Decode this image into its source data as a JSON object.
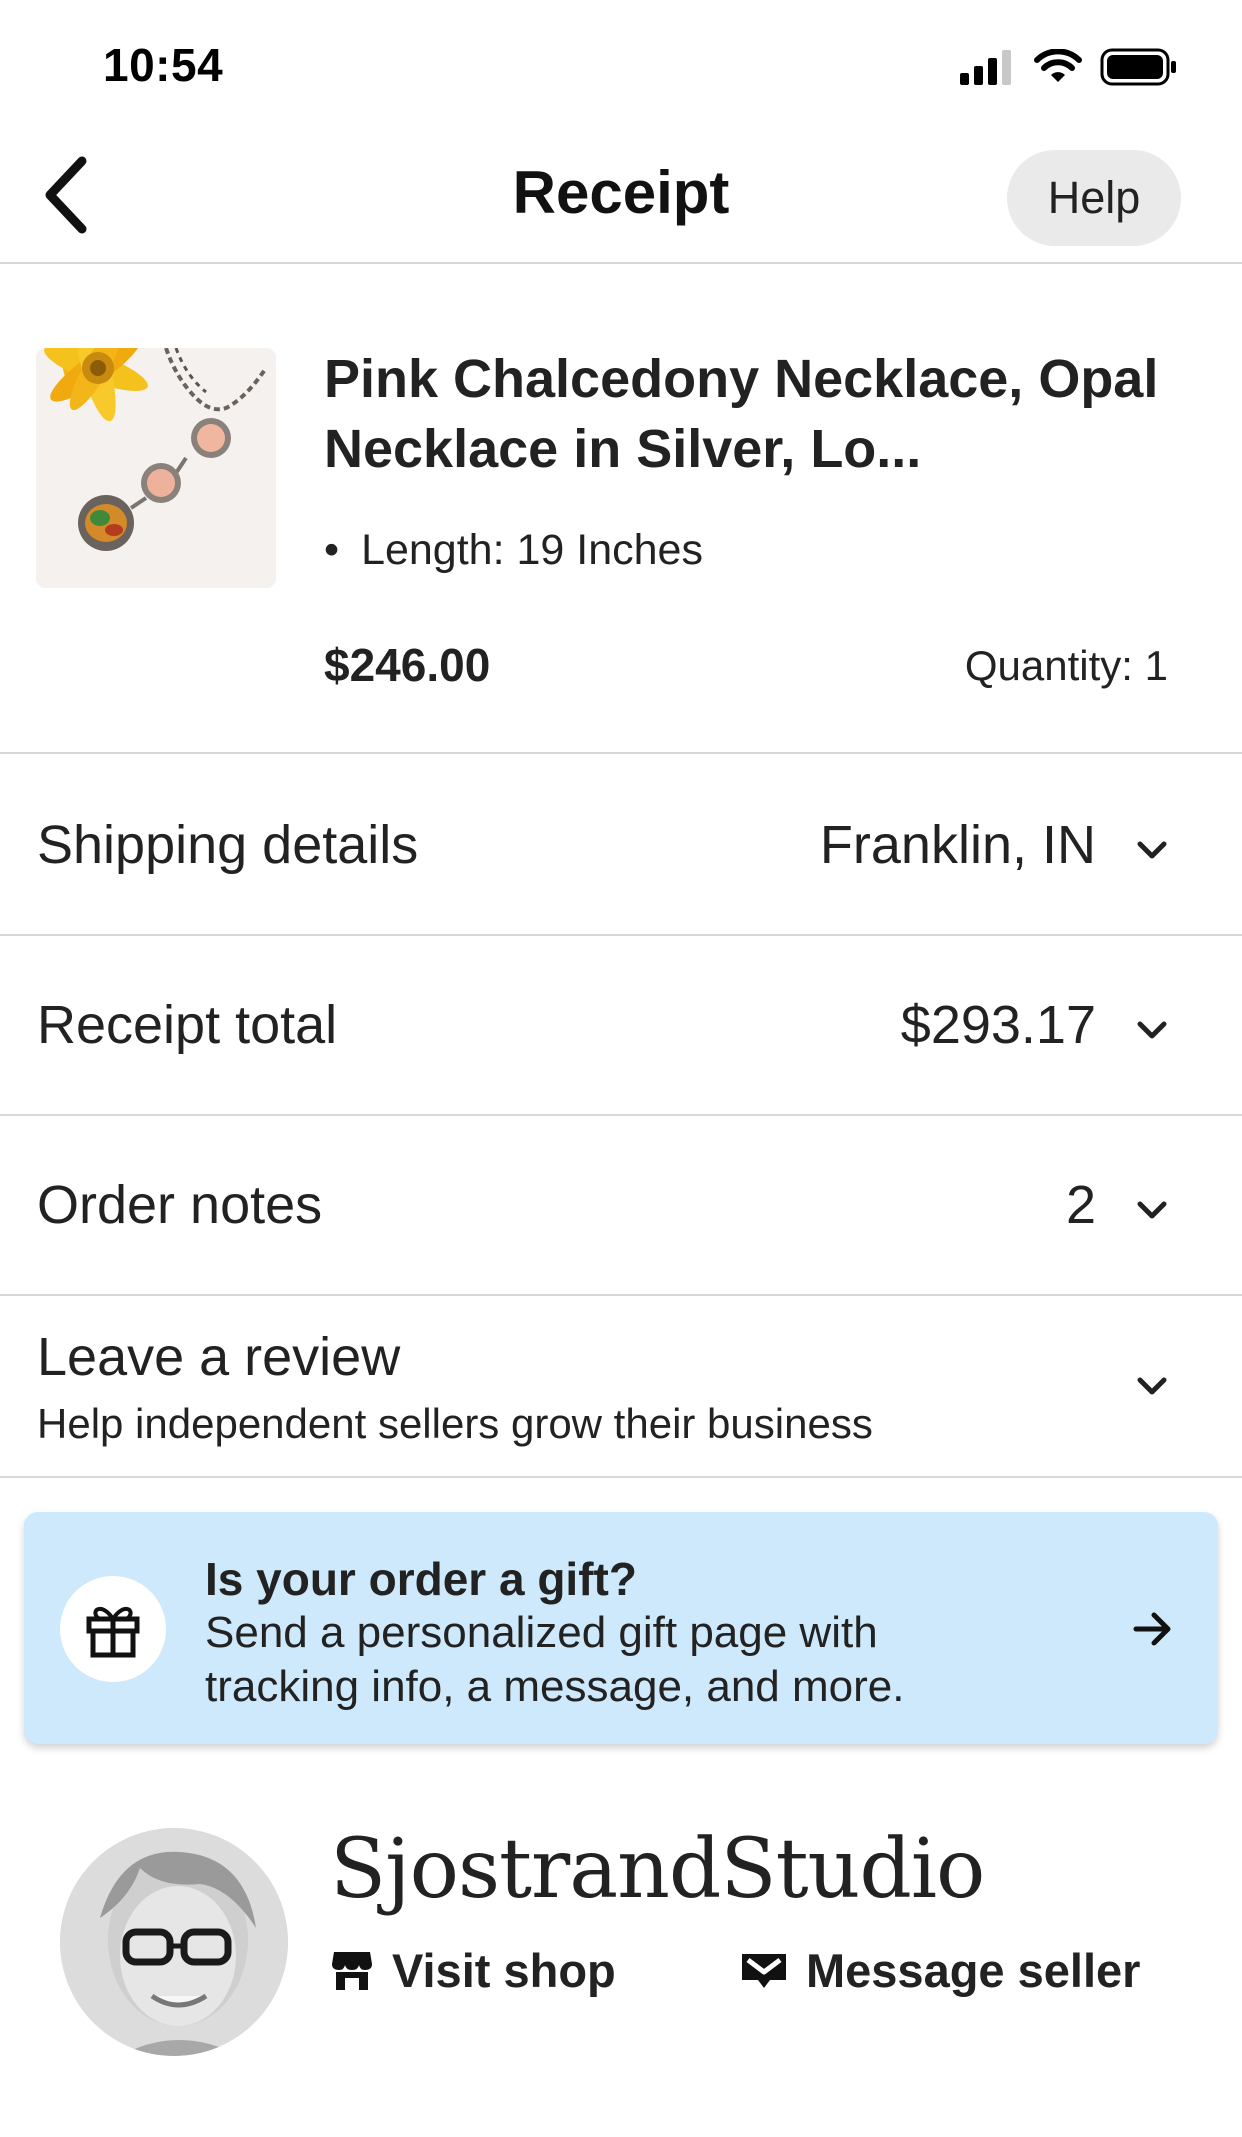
{
  "status_bar": {
    "time": "10:54"
  },
  "header": {
    "title": "Receipt",
    "help_label": "Help"
  },
  "item": {
    "title": "Pink Chalcedony Necklace, Opal Necklace in Silver, Lo...",
    "variation": "Length: 19 Inches",
    "price": "$246.00",
    "quantity": "Quantity: 1"
  },
  "rows": {
    "shipping": {
      "label": "Shipping details",
      "value": "Franklin, IN"
    },
    "total": {
      "label": "Receipt total",
      "value": "$293.17"
    },
    "notes": {
      "label": "Order notes",
      "value": "2"
    },
    "review": {
      "label": "Leave a review",
      "subtitle": "Help independent sellers grow their business"
    }
  },
  "gift": {
    "title": "Is your order a gift?",
    "description": "Send a personalized gift page with tracking info, a message, and more."
  },
  "seller": {
    "name": "SjostrandStudio",
    "visit_shop": "Visit shop",
    "message_seller": "Message seller"
  },
  "colors": {
    "gift_background": "#cde9fb",
    "help_background": "#eaeaea",
    "divider": "#d8d8d8"
  }
}
